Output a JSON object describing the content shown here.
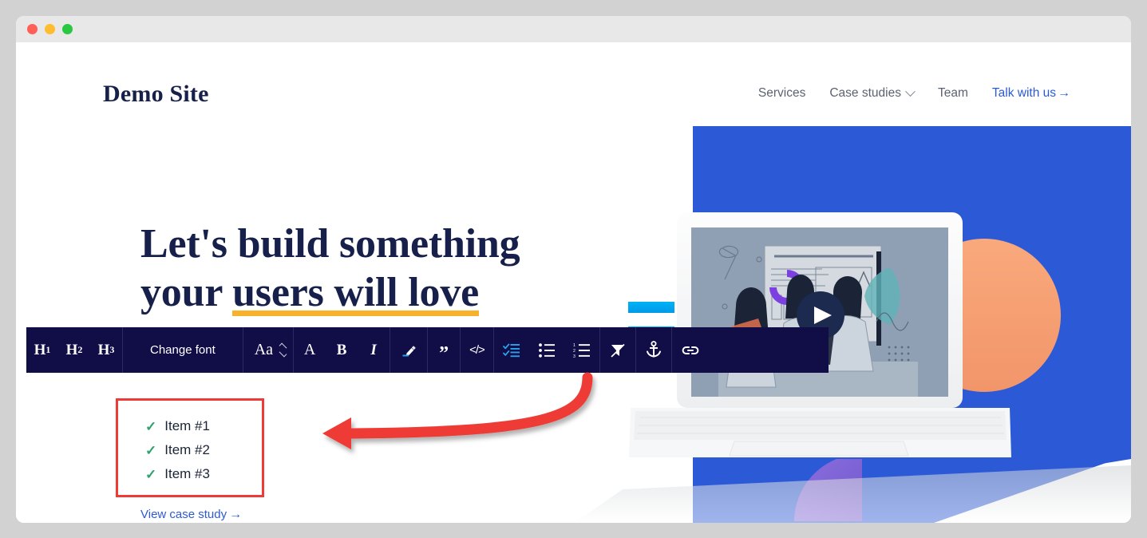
{
  "window": {
    "traffic_lights": [
      "close",
      "minimize",
      "zoom"
    ]
  },
  "site": {
    "brand": "Demo Site",
    "nav": [
      {
        "label": "Services",
        "type": "link"
      },
      {
        "label": "Case studies",
        "type": "dropdown"
      },
      {
        "label": "Team",
        "type": "link"
      },
      {
        "label": "Talk with us",
        "type": "cta",
        "arrow": "→"
      }
    ]
  },
  "hero": {
    "headline_line1": "Let's build something",
    "headline_line2_plain": "your ",
    "headline_line2_marked": "users will love",
    "highlight_color": "#f7b12a",
    "case_link": "View case study",
    "case_link_arrow": "→",
    "checklist": [
      {
        "check": "✓",
        "label": "Item #1"
      },
      {
        "check": "✓",
        "label": "Item #2"
      },
      {
        "check": "✓",
        "label": "Item #3"
      }
    ],
    "checklist_highlight_color": "#ef3b36",
    "check_color": "#2fa36b"
  },
  "toolbar": {
    "background": "#100d47",
    "active_color": "#2e9fe8",
    "groups": [
      {
        "name": "headings",
        "buttons": [
          {
            "name": "heading-1-button",
            "label": "H",
            "sub": "1",
            "icon": "heading-1-icon",
            "active": false
          },
          {
            "name": "heading-2-button",
            "label": "H",
            "sub": "2",
            "icon": "heading-2-icon",
            "active": false
          },
          {
            "name": "heading-3-button",
            "label": "H",
            "sub": "3",
            "icon": "heading-3-icon",
            "active": false
          }
        ]
      },
      {
        "name": "font",
        "buttons": [
          {
            "name": "change-font-button",
            "label": "Change font",
            "icon": "change-font-icon",
            "active": false
          }
        ]
      },
      {
        "name": "font-size",
        "buttons": [
          {
            "name": "font-size-stepper",
            "label": "Aa",
            "icon": "font-size-icon",
            "active": false
          }
        ]
      },
      {
        "name": "text-style",
        "buttons": [
          {
            "name": "text-color-button",
            "label": "A",
            "icon": "text-color-icon",
            "active": false
          },
          {
            "name": "bold-button",
            "label": "B",
            "icon": "bold-icon",
            "active": false
          },
          {
            "name": "italic-button",
            "label": "I",
            "icon": "italic-icon",
            "active": false
          }
        ]
      },
      {
        "name": "highlighter",
        "buttons": [
          {
            "name": "highlighter-button",
            "label": "",
            "icon": "highlighter-icon",
            "active": false
          }
        ]
      },
      {
        "name": "quote",
        "buttons": [
          {
            "name": "blockquote-button",
            "label": "”",
            "icon": "quote-icon",
            "active": false
          }
        ]
      },
      {
        "name": "code",
        "buttons": [
          {
            "name": "code-block-button",
            "label": "</>",
            "icon": "code-icon",
            "active": false
          }
        ]
      },
      {
        "name": "lists",
        "buttons": [
          {
            "name": "checklist-button",
            "label": "",
            "icon": "checklist-icon",
            "active": true
          },
          {
            "name": "bulleted-list-button",
            "label": "",
            "icon": "bulleted-list-icon",
            "active": false
          },
          {
            "name": "numbered-list-button",
            "label": "",
            "icon": "numbered-list-icon",
            "active": false
          }
        ]
      },
      {
        "name": "clear-format",
        "buttons": [
          {
            "name": "clear-formatting-button",
            "label": "",
            "icon": "clear-formatting-icon",
            "active": false
          }
        ]
      },
      {
        "name": "anchor",
        "buttons": [
          {
            "name": "anchor-button",
            "label": "",
            "icon": "anchor-icon",
            "active": false
          }
        ]
      },
      {
        "name": "link",
        "buttons": [
          {
            "name": "insert-link-button",
            "label": "",
            "icon": "link-icon",
            "active": false
          }
        ]
      }
    ]
  },
  "annotation": {
    "arrow_color": "#ef3b36",
    "description": "curved arrow from checklist toolbar button to checklist content box"
  },
  "illustration": {
    "blue_panel_color": "#2c5ad6",
    "orange_circle_color": "#f79e6d",
    "purple_wedge_color": "#7e62d4",
    "cyan_bar_color": "#00a8f0",
    "play_button_color": "#1b2a4e"
  }
}
